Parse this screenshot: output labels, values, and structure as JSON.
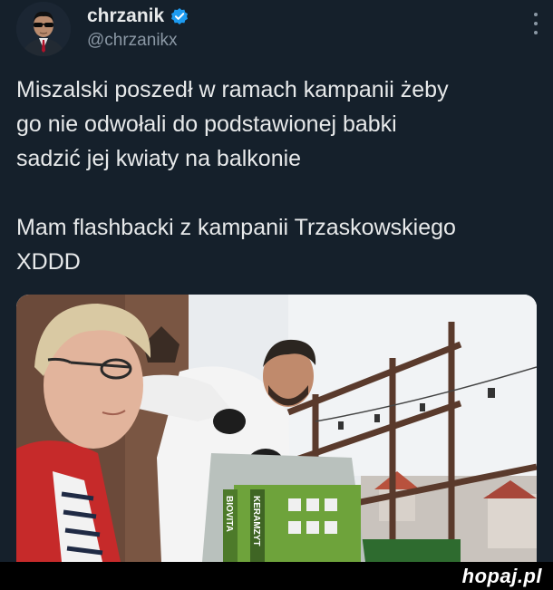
{
  "user": {
    "display_name": "chrzanik",
    "handle": "@chrzanikx",
    "verified": true,
    "avatar_icon": "avatar-sunglasses-man",
    "verified_icon": "verified-badge-icon"
  },
  "tweet": {
    "paragraphs": [
      "Miszalski poszedł w ramach kampanii żeby",
      "go nie odwołali do podstawionej babki",
      "sadzić jej kwiaty na balkonie",
      "Mam flashbacki z kampanii Trzaskowskiego",
      "XDDD"
    ]
  },
  "media": {
    "icon": "photo-man-planting-flowers-on-balcony",
    "bag_labels": [
      "BIOVITA",
      "KERAMZYT"
    ]
  },
  "more_menu_icon": "more-dots-icon",
  "watermark": {
    "text": "hopaj.pl"
  },
  "colors": {
    "background": "#15202b",
    "text": "#e7e9ea",
    "secondary_text": "#8b98a5",
    "verified": "#1d9bf0",
    "footer": "#000000"
  }
}
